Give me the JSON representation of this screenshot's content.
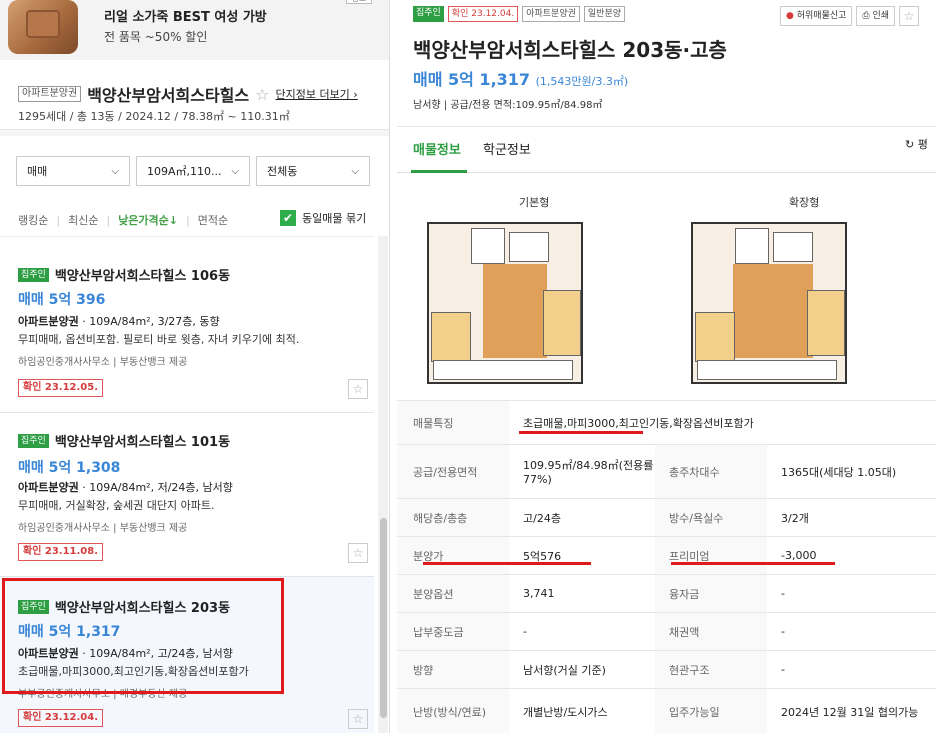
{
  "ad": {
    "badge": "광고",
    "title": "리얼 소가죽 BEST 여성 가방",
    "subtitle": "전 품목 ~50% 할인"
  },
  "complex": {
    "tag": "아파트분양권",
    "name": "백양산부암서희스타힐스",
    "detail_link": "단지정보 더보기",
    "info": "1295세대 / 총 13동 / 2024.12 / 78.38㎡ ~ 110.31㎡"
  },
  "filters": {
    "trade_type": "매매",
    "area": "109A㎡,110...",
    "building": "전체동"
  },
  "sort": {
    "options": [
      "랭킹순",
      "최신순",
      "낮은가격순↓",
      "면적순"
    ],
    "active_index": 2,
    "group_label": "동일매물 묶기"
  },
  "listings": [
    {
      "tag": "집주인",
      "name": "백양산부암서희스타힐스 106동",
      "price": "매매 5억 396",
      "type": "아파트분양권",
      "spec": "109A/84m², 3/27층, 동향",
      "desc": "무피매매, 옵션비포함. 필로티 바로 윗층, 자녀 키우기에 최적.",
      "agent": "하임공인중개사사무소 | 부동산뱅크 제공",
      "confirm": "확인 23.12.05."
    },
    {
      "tag": "집주인",
      "name": "백양산부암서희스타힐스 101동",
      "price": "매매 5억 1,308",
      "type": "아파트분양권",
      "spec": "109A/84m², 저/24층, 남서향",
      "desc": "무피매매, 거실확장, 숲세권 대단지 아파트.",
      "agent": "하임공인중개사사무소 | 부동산뱅크 제공",
      "confirm": "확인 23.11.08."
    },
    {
      "tag": "집주인",
      "name": "백양산부암서희스타힐스 203동",
      "price": "매매 5억 1,317",
      "type": "아파트분양권",
      "spec": "109A/84m², 고/24층, 남서향",
      "desc": "초급매물,마피3000,최고인기동,확장옵션비포함가",
      "agent": "부부공인중개사사무소 | 매경부동산 제공",
      "confirm": "확인 23.12.04."
    }
  ],
  "detail": {
    "tags": [
      "집주인",
      "확인 23.12.04.",
      "아파트분양권",
      "일반분양"
    ],
    "report_button": "허위매물신고",
    "print_button": "인쇄",
    "title": "백양산부암서희스타힐스 203동·고층",
    "price": "매매 5억 1,317",
    "price_per": "(1,543만원/3.3㎡)",
    "meta": "남서향 | 공급/전용 면적:109.95㎡/84.98㎡",
    "tabs": [
      "매물정보",
      "학군정보"
    ],
    "refresh": "평",
    "plan_labels": [
      "기본형",
      "확장형"
    ],
    "rows": [
      {
        "label": "매물특징",
        "value": "초급매물,마피3000,최고인기동,확장옵션비포함가"
      },
      {
        "label": "공급/전용면적",
        "value": "109.95㎡/84.98㎡(전용률77%)",
        "label2": "총주차대수",
        "value2": "1365대(세대당 1.05대)"
      },
      {
        "label": "해당층/총층",
        "value": "고/24층",
        "label2": "방수/욕실수",
        "value2": "3/2개"
      },
      {
        "label": "분양가",
        "value": "5억576",
        "label2": "프리미엄",
        "value2": "-3,000"
      },
      {
        "label": "분양옵션",
        "value": "3,741",
        "label2": "융자금",
        "value2": "-"
      },
      {
        "label": "납부중도금",
        "value": "-",
        "label2": "채권액",
        "value2": "-"
      },
      {
        "label": "방향",
        "value": "남서향(거실 기준)",
        "label2": "현관구조",
        "value2": "-"
      },
      {
        "label": "난방(방식/연료)",
        "value": "개별난방/도시가스",
        "label2": "입주가능일",
        "value2": "2024년 12월 31일 협의가능"
      }
    ]
  },
  "colors": {
    "green": "#2e9e45",
    "price_blue": "#3a86d6",
    "highlight_red": "#e0191b"
  }
}
